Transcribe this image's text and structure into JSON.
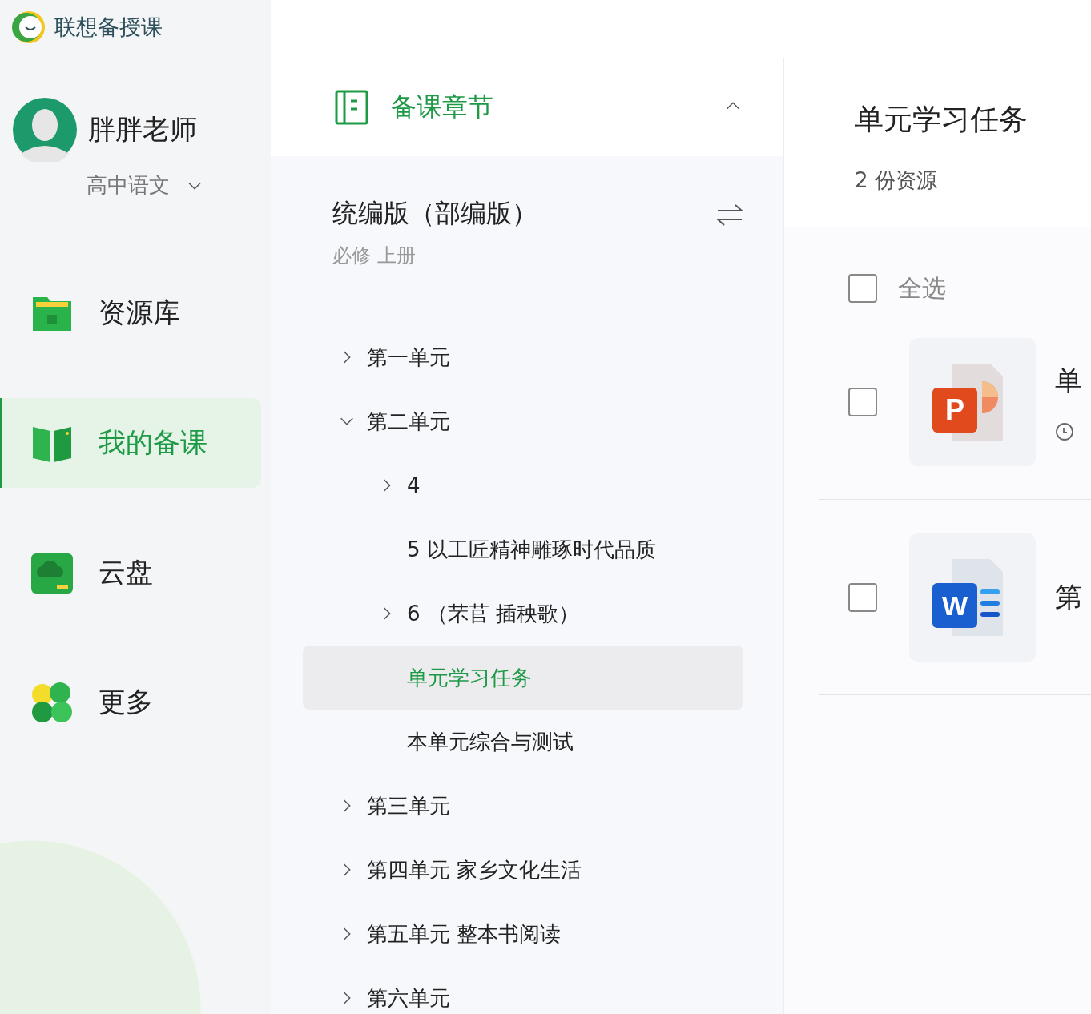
{
  "app": {
    "name": "联想备授课"
  },
  "user": {
    "name": "胖胖老师",
    "subject": "高中语文"
  },
  "nav": [
    {
      "kind": "library",
      "label": "资源库",
      "selected": false
    },
    {
      "kind": "lessons",
      "label": "我的备课",
      "selected": true
    },
    {
      "kind": "cloud",
      "label": "云盘",
      "selected": false
    },
    {
      "kind": "more",
      "label": "更多",
      "selected": false
    }
  ],
  "chapters": {
    "title": "备课章节",
    "expanded": true,
    "textbook": "统编版（部编版）",
    "volume": "必修 上册",
    "tree": [
      {
        "label": "第一单元",
        "kind": "folder",
        "expanded": false,
        "selected": false
      },
      {
        "label": "第二单元",
        "kind": "folder",
        "expanded": true,
        "selected": false,
        "children": [
          {
            "label": "4",
            "kind": "folder",
            "expanded": false,
            "selected": false
          },
          {
            "label": "5 以工匠精神雕琢时代品质",
            "kind": "leaf",
            "selected": false
          },
          {
            "label": "6 （芣苢 插秧歌）",
            "kind": "folder",
            "expanded": false,
            "selected": false
          },
          {
            "label": "单元学习任务",
            "kind": "leaf",
            "selected": true
          },
          {
            "label": "本单元综合与测试",
            "kind": "leaf",
            "selected": false
          }
        ]
      },
      {
        "label": "第三单元",
        "kind": "folder",
        "expanded": false,
        "selected": false
      },
      {
        "label": "第四单元 家乡文化生活",
        "kind": "folder",
        "expanded": false,
        "selected": false
      },
      {
        "label": "第五单元 整本书阅读",
        "kind": "folder",
        "expanded": false,
        "selected": false
      },
      {
        "label": "第六单元",
        "kind": "folder",
        "expanded": false,
        "selected": false
      }
    ]
  },
  "content": {
    "title": "单元学习任务",
    "count": "2 份资源",
    "select_all": {
      "label": "全选",
      "checked": false
    },
    "files": [
      {
        "kind": "ppt",
        "icon_letter": "P",
        "title": "单",
        "checked": false,
        "show_time": true
      },
      {
        "kind": "word",
        "icon_letter": "W",
        "title": "第",
        "checked": false,
        "show_time": false
      }
    ]
  }
}
